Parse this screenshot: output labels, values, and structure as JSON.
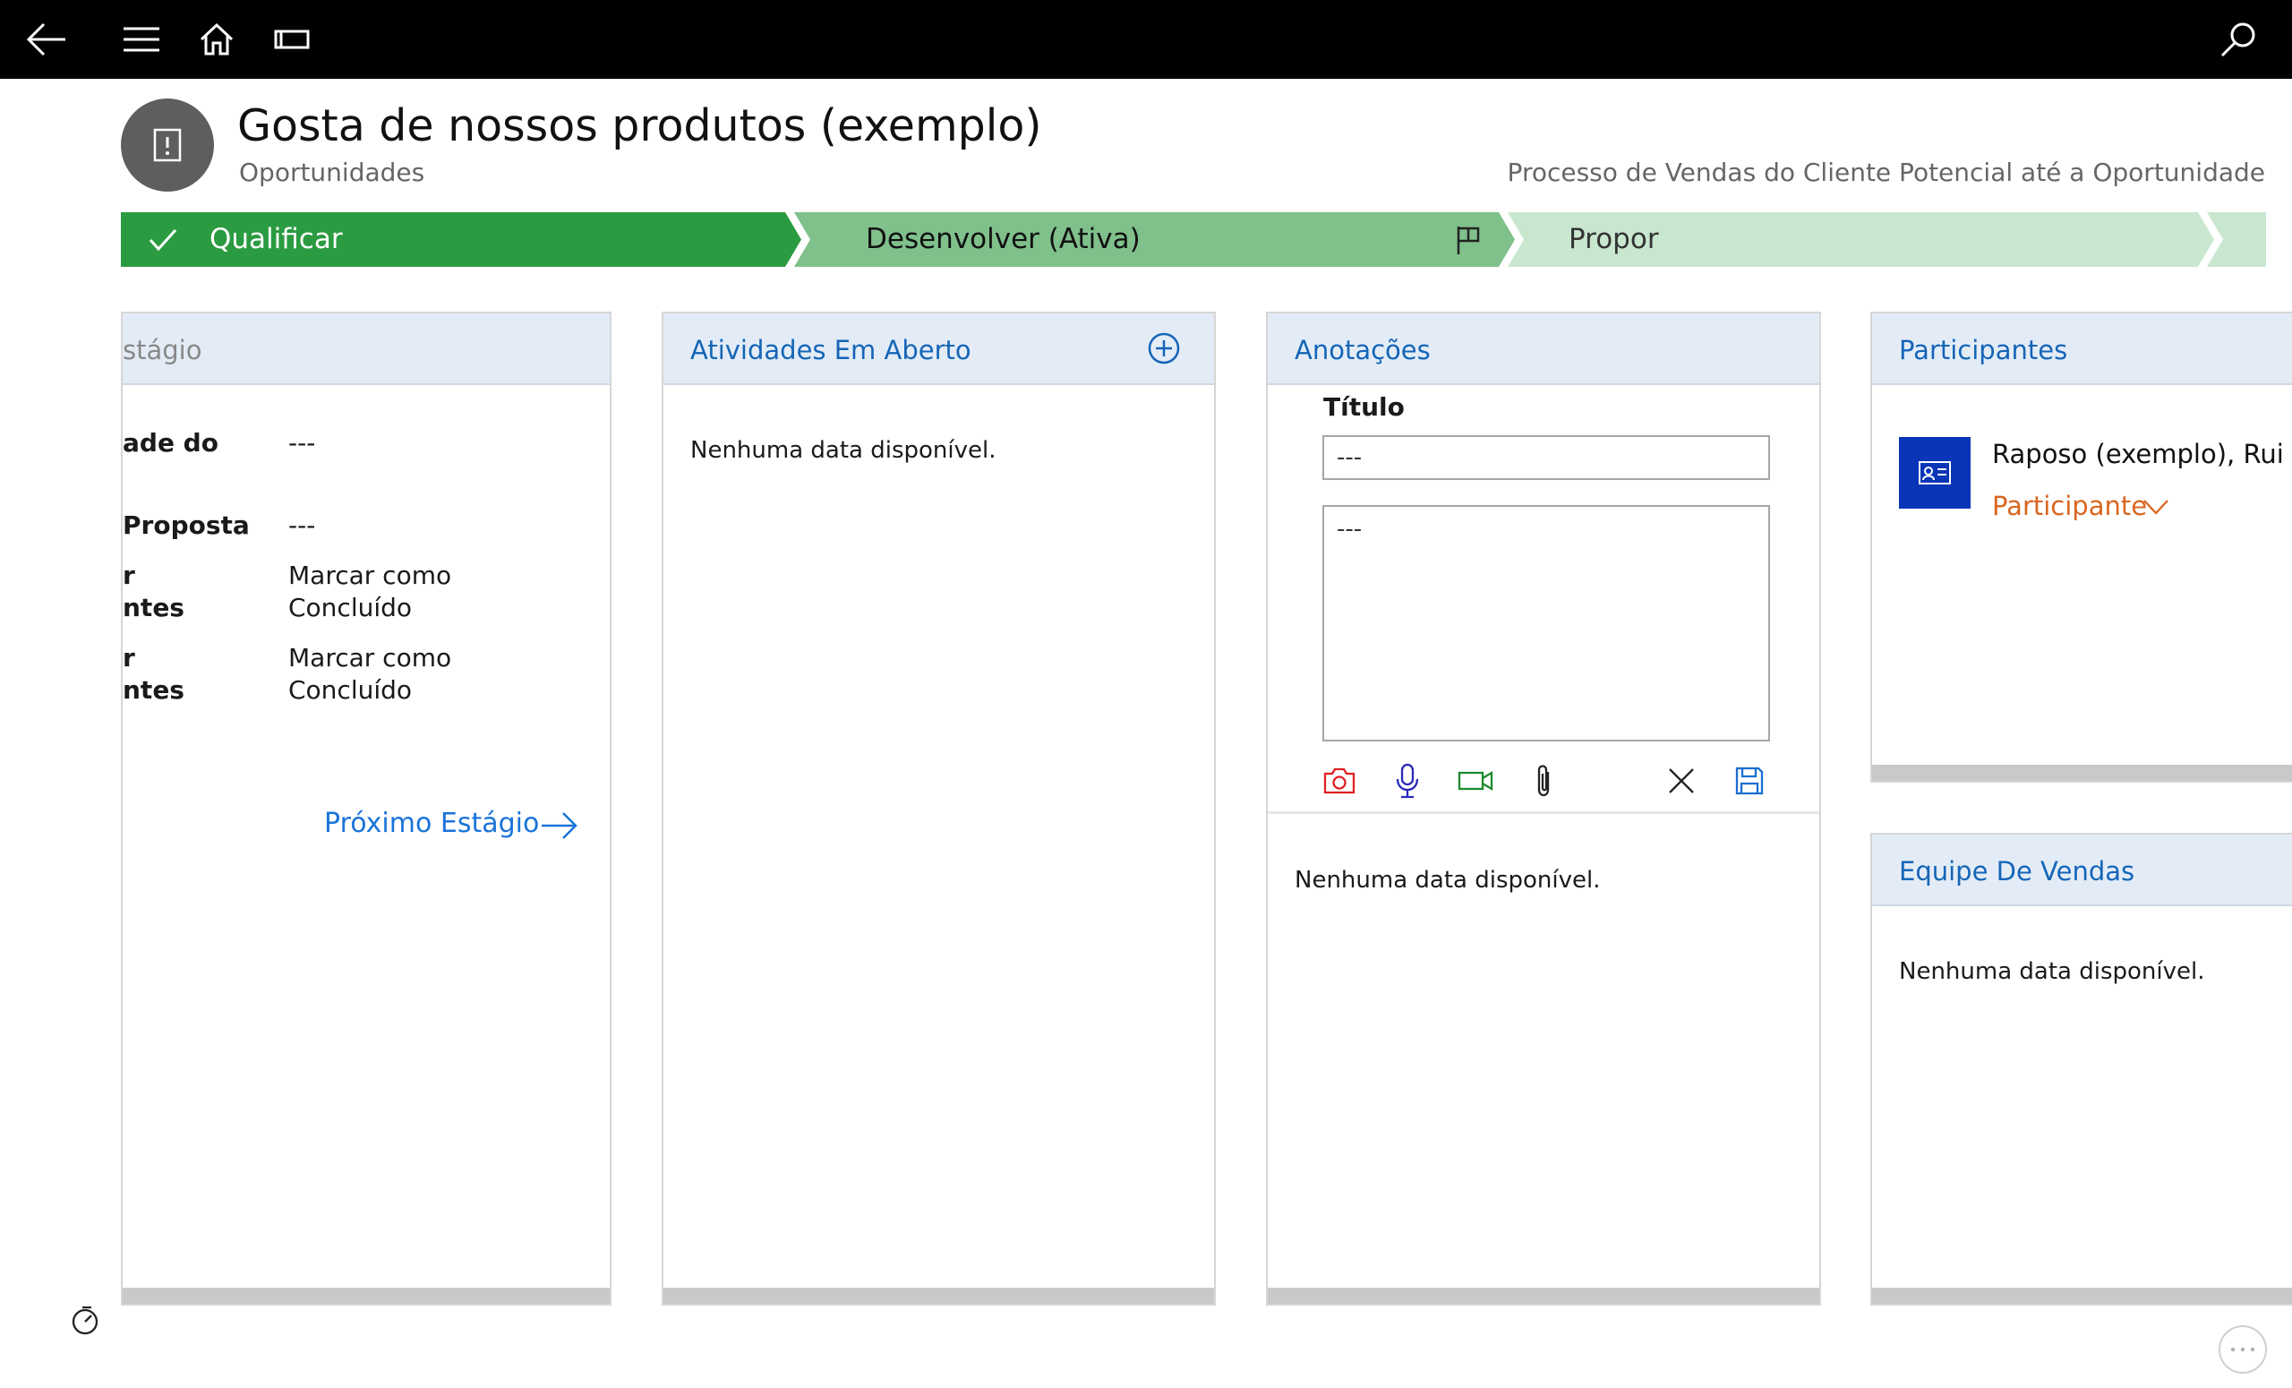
{
  "record": {
    "title": "Gosta de nossos produtos (exemplo)",
    "entity": "Oportunidades",
    "process": "Processo de Vendas do Cliente Potencial até a Oportunidade"
  },
  "stages": [
    {
      "label": "Qualificar",
      "state": "completed",
      "color": "#2b9b41"
    },
    {
      "label": "Desenvolver (Ativa)",
      "state": "active",
      "color": "#7fc08b"
    },
    {
      "label": "Propor",
      "state": "upcoming",
      "color": "#c9e7cf"
    }
  ],
  "stage_card": {
    "title_partial": "stágio",
    "fields": [
      {
        "label": "ade do",
        "value": "---"
      },
      {
        "label": "Proposta",
        "value": "---"
      },
      {
        "label_lines": [
          "r",
          "ntes"
        ],
        "value_lines": [
          "Marcar como",
          "Concluído"
        ]
      },
      {
        "label_lines": [
          "r",
          "ntes"
        ],
        "value_lines": [
          "Marcar como",
          "Concluído"
        ]
      }
    ],
    "next_stage": "Próximo Estágio"
  },
  "activities": {
    "title": "Atividades Em Aberto",
    "empty": "Nenhuma data disponível."
  },
  "notes": {
    "title": "Anotações",
    "field_label": "Título",
    "title_value": "---",
    "body_value": "---",
    "empty": "Nenhuma data disponível.",
    "tools": [
      "camera-icon",
      "microphone-icon",
      "video-icon",
      "attachment-icon",
      "close-icon",
      "save-icon"
    ]
  },
  "participants": {
    "title": "Participantes",
    "items": [
      {
        "name": "Raposo (exemplo), Rui",
        "role": "Participante"
      }
    ]
  },
  "sales_team": {
    "title": "Equipe De Vendas",
    "empty": "Nenhuma data disponível."
  },
  "colors": {
    "accent_blue": "#1565b8",
    "role_orange": "#d9661f",
    "contact_tile": "#0b35b8"
  }
}
